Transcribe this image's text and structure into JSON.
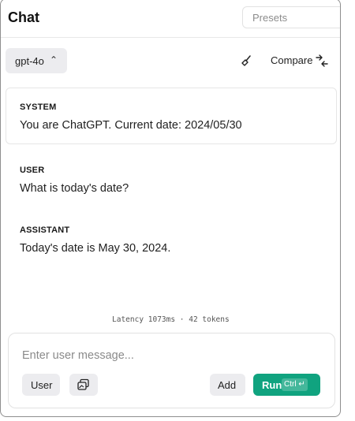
{
  "header": {
    "title": "Chat",
    "presets_placeholder": "Presets"
  },
  "toolbar": {
    "model": "gpt-4o",
    "model_caret": "⌃",
    "compare_label": "Compare"
  },
  "messages": [
    {
      "role": "SYSTEM",
      "text": "You are ChatGPT. Current date: 2024/05/30"
    },
    {
      "role": "USER",
      "text": "What is today's date?"
    },
    {
      "role": "ASSISTANT",
      "text": "Today's date is May 30, 2024."
    }
  ],
  "status": {
    "latency": "Latency 1073ms · 42 tokens"
  },
  "composer": {
    "placeholder": "Enter user message...",
    "role_button": "User",
    "add_button": "Add",
    "run_button": "Run",
    "shortcut": "Ctrl ↵"
  },
  "colors": {
    "accent": "#10a37f",
    "button_gray": "#ececef"
  },
  "icons": [
    "broom-icon",
    "compare-icon",
    "image-attach-icon",
    "chevron-updown-icon"
  ]
}
